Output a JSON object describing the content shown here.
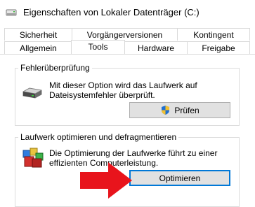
{
  "window": {
    "title": "Eigenschaften von Lokaler Datenträger (C:)"
  },
  "tabs": {
    "row1": [
      "Sicherheit",
      "Vorgängerversionen",
      "Kontingent"
    ],
    "row2": [
      "Allgemein",
      "Tools",
      "Hardware",
      "Freigabe"
    ],
    "active": "Tools"
  },
  "error_check": {
    "title": "Fehlerüberprüfung",
    "description_line1": "Mit dieser Option wird das Laufwerk auf",
    "description_line2": "Dateisystemfehler überprüft.",
    "button_label": "Prüfen"
  },
  "optimize": {
    "title": "Laufwerk optimieren und defragmentieren",
    "description_line1": "Die Optimierung der Laufwerke führt zu einer",
    "description_line2": "effizienten Computerleistung.",
    "button_label": "Optimieren"
  },
  "colors": {
    "accent": "#0078d7",
    "arrow": "#e8141c"
  }
}
